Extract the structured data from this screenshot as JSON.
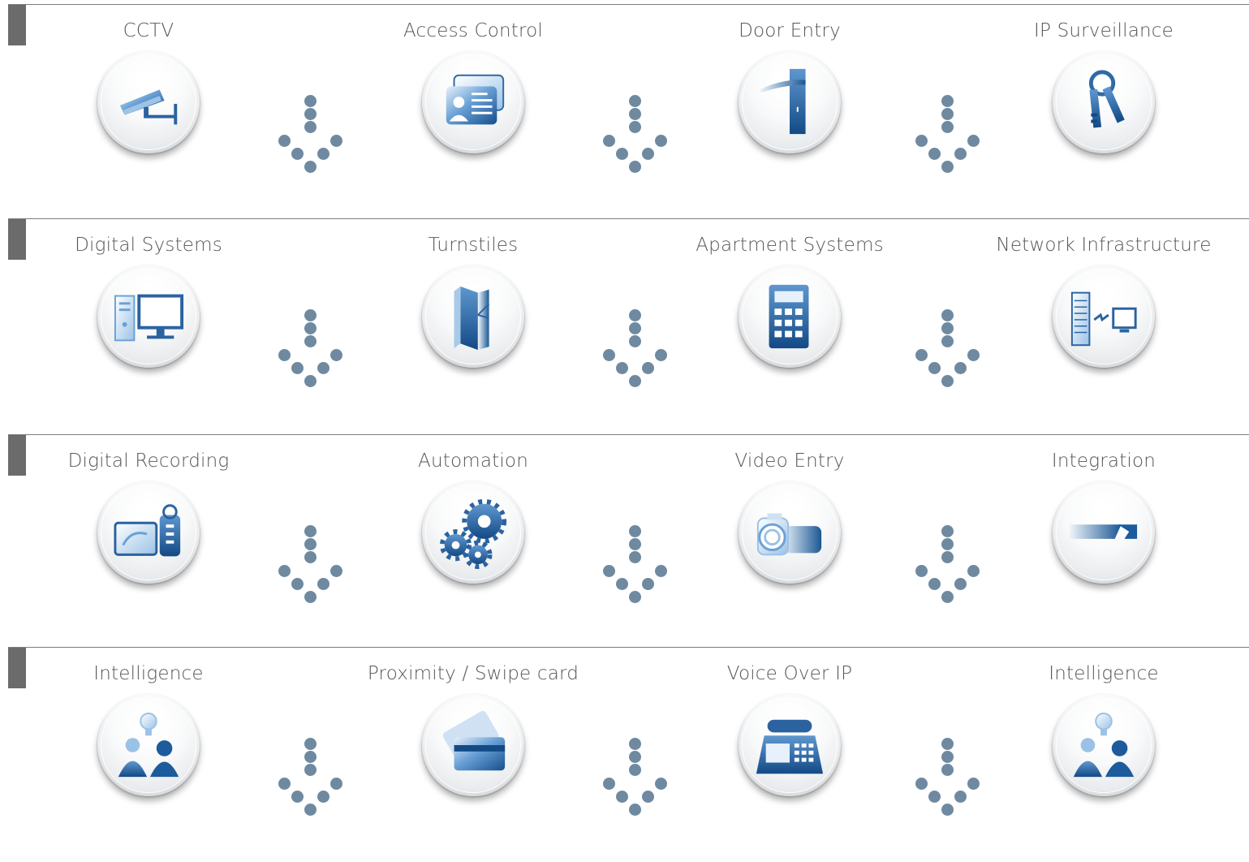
{
  "colors": {
    "accent": "#1c5b9c",
    "dots": "#6f8aa0",
    "divider": "#7c7c7c"
  },
  "rows": [
    {
      "items": [
        {
          "label": "CCTV",
          "icon": "cctv-camera-icon"
        },
        {
          "label": "Access Control",
          "icon": "id-card-icon"
        },
        {
          "label": "Door Entry",
          "icon": "door-handle-icon"
        },
        {
          "label": "IP Surveillance",
          "icon": "keys-icon"
        }
      ]
    },
    {
      "items": [
        {
          "label": "Digital Systems",
          "icon": "desktop-computer-icon"
        },
        {
          "label": "Turnstiles",
          "icon": "turnstile-icon"
        },
        {
          "label": "Apartment Systems",
          "icon": "keypad-icon"
        },
        {
          "label": "Network Infrastructure",
          "icon": "network-server-icon"
        }
      ]
    },
    {
      "items": [
        {
          "label": "Digital Recording",
          "icon": "video-recorder-icon"
        },
        {
          "label": "Automation",
          "icon": "gears-icon"
        },
        {
          "label": "Video Entry",
          "icon": "video-camera-icon"
        },
        {
          "label": "Integration",
          "icon": "arrow-integration-icon"
        }
      ]
    },
    {
      "items": [
        {
          "label": "Intelligence",
          "icon": "people-idea-icon"
        },
        {
          "label": "Proximity / Swipe card",
          "icon": "swipe-card-icon"
        },
        {
          "label": "Voice Over IP",
          "icon": "voip-phone-icon"
        },
        {
          "label": "Intelligence",
          "icon": "people-idea-icon"
        }
      ]
    }
  ]
}
